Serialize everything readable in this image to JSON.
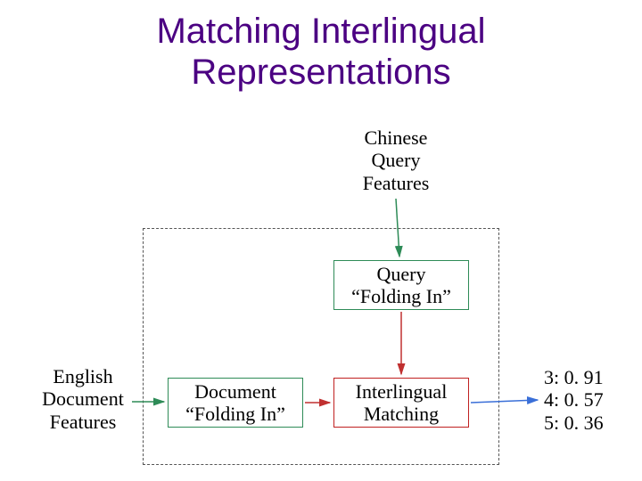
{
  "title_line1": "Matching Interlingual",
  "title_line2": "Representations",
  "labels": {
    "chinese_l1": "Chinese",
    "chinese_l2": "Query",
    "chinese_l3": "Features",
    "english_l1": "English",
    "english_l2": "Document",
    "english_l3": "Features"
  },
  "boxes": {
    "query_l1": "Query",
    "query_l2": "“Folding In”",
    "doc_l1": "Document",
    "doc_l2": "“Folding In”",
    "match_l1": "Interlingual",
    "match_l2": "Matching"
  },
  "results": {
    "r1": "3: 0. 91",
    "r2": "4: 0. 57",
    "r3": "5: 0. 36"
  },
  "colors": {
    "title": "#4b0082",
    "green_box": "#2e8b57",
    "red_box": "#c02020",
    "green_arrow": "#2e8b57",
    "red_arrow": "#c03030",
    "blue_arrow": "#3a6fd8"
  }
}
